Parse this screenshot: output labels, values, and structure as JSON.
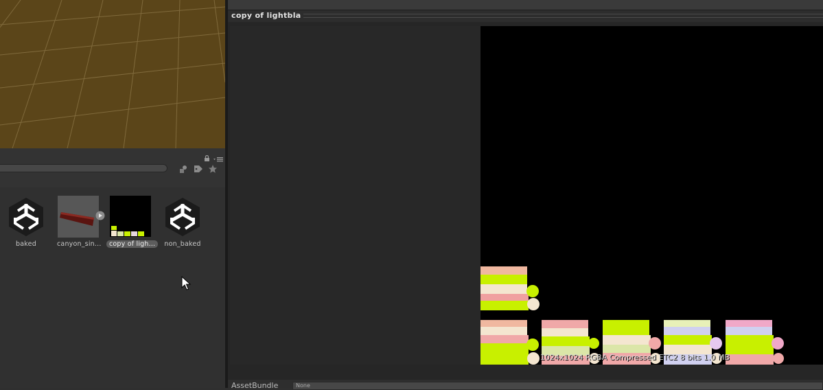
{
  "inspector": {
    "title": "copy of lightbla",
    "texture_info": "1024x1024  RGBA Compressed ETC2 8 bits   1.0 MB"
  },
  "assetbundle": {
    "label": "AssetBundle",
    "value": "None"
  },
  "assets": [
    {
      "name": "baked",
      "icon": "unity-logo-icon"
    },
    {
      "name": "canyon_sin...",
      "icon": "mesh-thumbnail-icon"
    },
    {
      "name": "copy of ligh...",
      "icon": "texture-thumbnail-icon"
    },
    {
      "name": "non_baked",
      "icon": "unity-logo-icon"
    }
  ],
  "toolbar": {
    "icons": [
      "lock-icon",
      "panel-menu-icon",
      "filter-by-type-icon",
      "filter-by-label-icon",
      "favorite-star-icon"
    ]
  },
  "colors": {
    "scene_ground": "#5b4519",
    "texture_bg": "#000000",
    "lime": "#c8f000",
    "cream": "#f4e6d0",
    "pink": "#f0a8a8"
  }
}
